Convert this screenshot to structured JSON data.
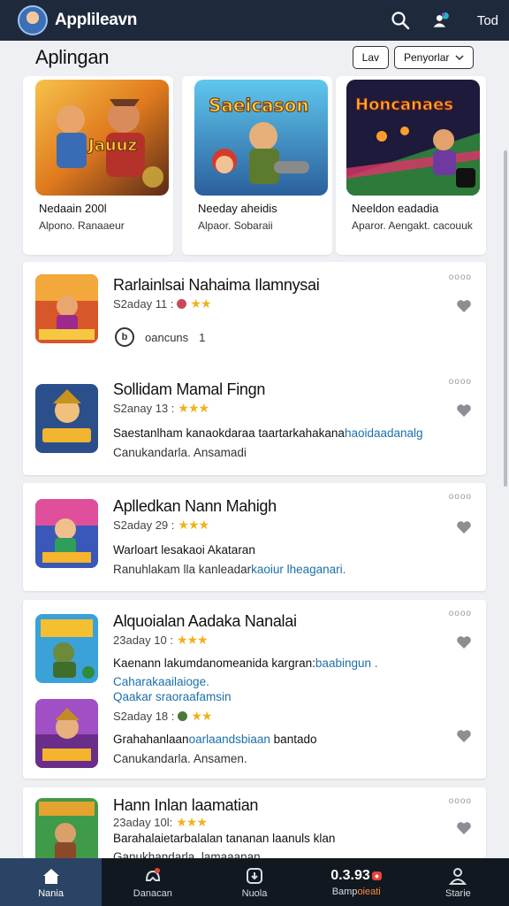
{
  "header": {
    "app_title": "Applileavn",
    "right_text": "Tod",
    "icons": [
      "search-icon",
      "profile-sparkle-icon"
    ]
  },
  "featured": {
    "title": "Aplingan",
    "btn_filter": "Lav",
    "btn_sort": "Penyorlar",
    "cards": [
      {
        "art": "Jauuz",
        "name": "Nedaain 200l",
        "sub": "Alpono. Ranaaeur"
      },
      {
        "art": "Saeicason",
        "name": "Needay aheidis",
        "sub": "Alpaor. Sobaraii"
      },
      {
        "art": "Honcanaes",
        "name": "Neeldon eadadia",
        "sub": "Aparor. Aengakt. cacouuk"
      }
    ]
  },
  "list1": {
    "items": [
      {
        "title": "Rarlainlsai Nahaima Ilamnysai",
        "meta": "S2aday 11 :",
        "dots": "oooo",
        "caps_label": "oancuns",
        "caps_count": "1",
        "caps_icon": "b"
      },
      {
        "title": "Sollidam Mamal Fingn",
        "meta": "S2anay 13 :",
        "dots": "oooo",
        "desc": "Saestanlham kanaokdaraa taartarkahakana",
        "desc_hl": "haoidaadanalg",
        "desc2": "Canukandarla. Ansamadi"
      }
    ]
  },
  "list2": {
    "items": [
      {
        "title": "Aplledkan Nann Mahigh",
        "meta": "S2aday 29 :",
        "dots": "oooo",
        "desc": "Warloart lesakaoi Akataran",
        "desc2": "Ranuhlakam lla kanleadar",
        "desc2_hl": "kaoiur lheaganari."
      }
    ]
  },
  "list3": {
    "items": [
      {
        "title": "Alquoialan Aadaka Nanalai",
        "meta": "23aday 10 :",
        "dots": "oooo",
        "desc": "Kaenann lakumdanomeanida kargran:",
        "desc_hl": "baabingun .",
        "desc_link": "Caharakaailaioge.",
        "desc_link2": "Qaakar sraoraafamsin"
      },
      {
        "title": "",
        "meta": "S2aday 18 :",
        "dots": "",
        "desc": "Grahahanlaan",
        "desc_hl": "oarlaandsbiaan",
        "desc_end": "bantado",
        "desc2": "Canukandarla. Ansamen."
      }
    ]
  },
  "list4": {
    "items": [
      {
        "title": "Hann Inlan laamatian",
        "meta": "23aday 10l:",
        "dots": "oooo",
        "desc": "Barahalaietarbalalan tananan laanuls klan",
        "desc2": "Ganukhandarla. lamaaanan"
      }
    ]
  },
  "bottom_nav": [
    {
      "label": "Nania",
      "icon": "home-icon",
      "active": true
    },
    {
      "label": "Danacan",
      "icon": "game-controller-icon"
    },
    {
      "label": "Nuola",
      "icon": "download-icon"
    },
    {
      "label": "Bamp",
      "label_hl": "oieati",
      "count": "0.3.93",
      "icon": "updates-icon"
    },
    {
      "label": "Starie",
      "icon": "user-icon"
    }
  ],
  "colors": {
    "topbar": "#1e2a3c",
    "accent_link": "#1d6fa8",
    "star": "#f2b01e",
    "nav_active": "#2b4466"
  }
}
